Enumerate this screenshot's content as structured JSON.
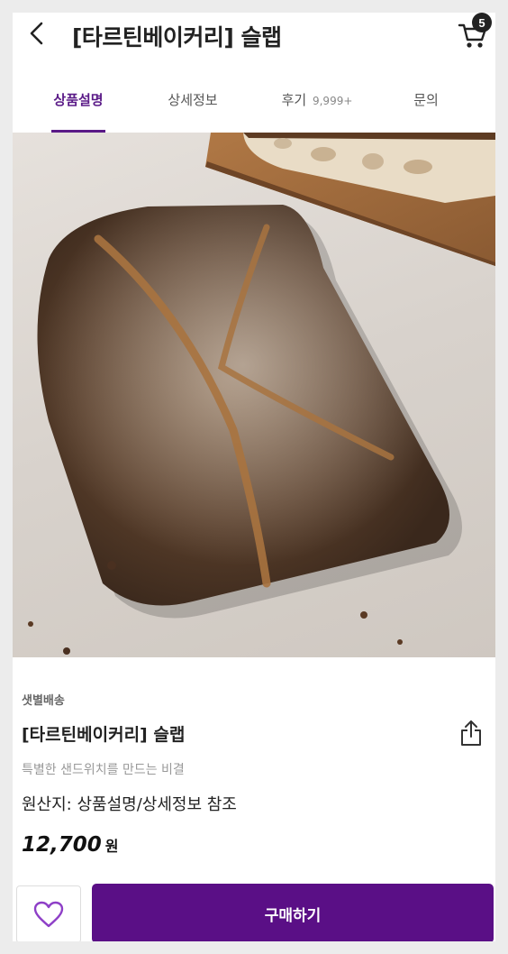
{
  "header": {
    "title": "[타르틴베이커리] 슬랩",
    "cart_count": "5",
    "back_icon": "chevron-left-icon",
    "cart_icon": "cart-icon"
  },
  "tabs": [
    {
      "label": "상품설명",
      "active": true
    },
    {
      "label": "상세정보",
      "active": false
    },
    {
      "label": "후기",
      "count": "9,999+",
      "active": false
    },
    {
      "label": "문의",
      "active": false
    }
  ],
  "product": {
    "delivery_type": "샛별배송",
    "name": "[타르틴베이커리] 슬랩",
    "subtitle": "특별한 샌드위치를 만드는 비결",
    "origin": "원산지: 상품설명/상세정보 참조",
    "price": "12,700",
    "currency": "원",
    "share_icon": "share-icon"
  },
  "actions": {
    "wish_icon": "heart-icon",
    "buy_label": "구매하기"
  },
  "colors": {
    "accent": "#5a1a87",
    "buy_button": "#5a0f86"
  }
}
